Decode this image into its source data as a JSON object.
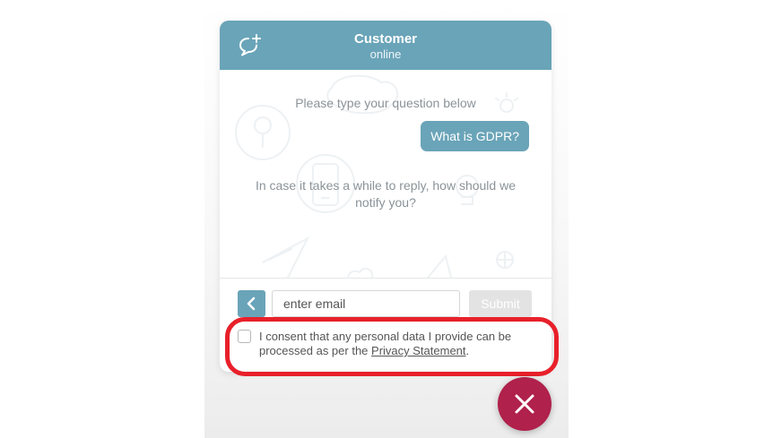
{
  "header": {
    "title": "Customer",
    "status": "online",
    "new_chat_icon": "chat-add-icon"
  },
  "messages": {
    "prompt": "Please type your question below",
    "user_message": "What is GDPR?",
    "notify_prompt": "In case it takes a while to reply, how should we notify you?"
  },
  "input": {
    "back_icon": "chevron-left-icon",
    "email_placeholder": "enter email",
    "email_value": "",
    "submit_label": "Submit"
  },
  "consent": {
    "checked": false,
    "text_before": "I consent that any personal data I provide can be processed as per the ",
    "link_text": "Privacy Statement",
    "text_after": "."
  },
  "close_button": {
    "icon": "close-icon"
  },
  "colors": {
    "accent": "#6aa4b8",
    "close": "#b0214c",
    "highlight": "#e8202a",
    "submit_disabled": "#e3e3e3",
    "muted_text": "#8a9399"
  }
}
